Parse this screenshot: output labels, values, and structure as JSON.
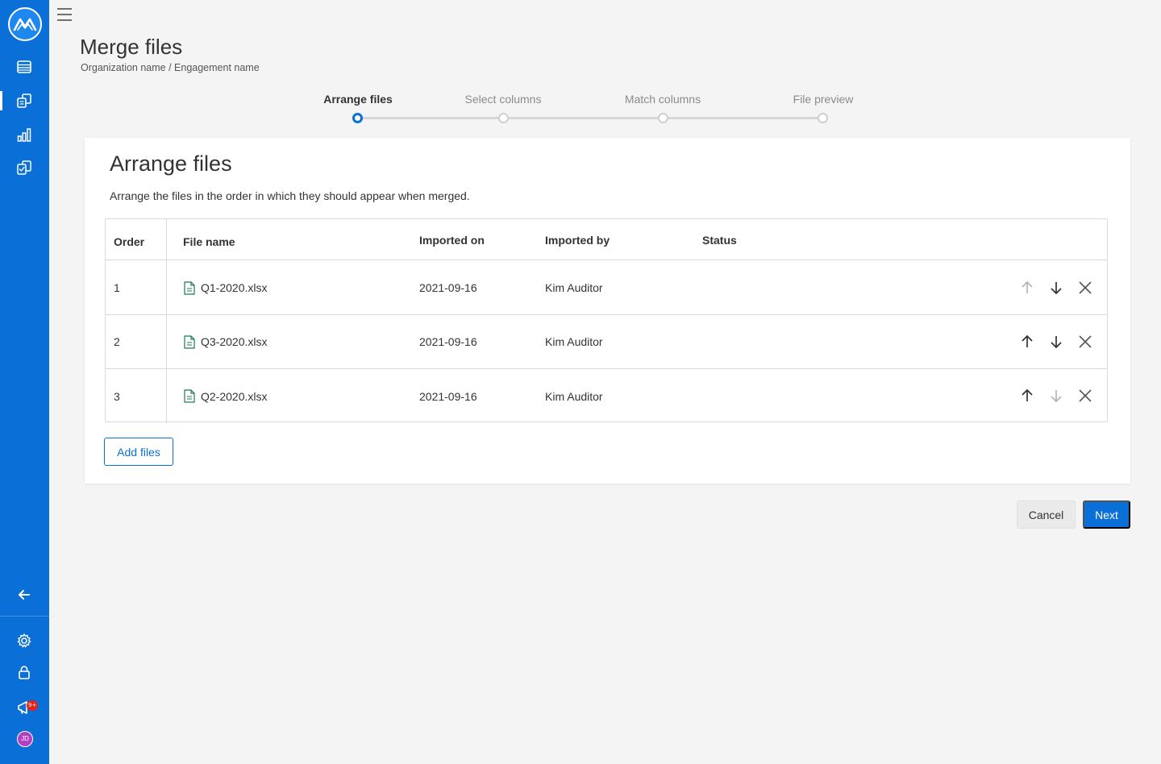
{
  "page": {
    "title": "Merge files",
    "breadcrumb": "Organization name / Engagement name"
  },
  "sidebar": {
    "items": [
      {
        "icon": "logo-icon"
      },
      {
        "icon": "table-icon"
      },
      {
        "icon": "files-icon",
        "active": true
      },
      {
        "icon": "bar-chart-icon"
      },
      {
        "icon": "checklist-icon"
      },
      {
        "icon": "collapse-arrow-icon"
      },
      {
        "icon": "gear-icon"
      },
      {
        "icon": "lock-icon"
      },
      {
        "icon": "megaphone-icon"
      },
      {
        "icon": "avatar"
      }
    ],
    "notification_badge": "9+",
    "avatar_initials": "JD"
  },
  "stepper": {
    "steps": [
      {
        "label": "Arrange files",
        "active": true
      },
      {
        "label": "Select columns",
        "active": false
      },
      {
        "label": "Match columns",
        "active": false
      },
      {
        "label": "File preview",
        "active": false
      }
    ]
  },
  "card": {
    "title": "Arrange files",
    "description": "Arrange the files in the order in which they should appear when merged."
  },
  "table": {
    "headers": {
      "order": "Order",
      "file_name": "File name",
      "imported_on": "Imported on",
      "imported_by": "Imported by",
      "status": "Status"
    },
    "rows": [
      {
        "order": "1",
        "file_name": "Q1-2020.xlsx",
        "imported_on": "2021-09-16",
        "imported_by": "Kim Auditor",
        "status": "",
        "up_enabled": false,
        "down_enabled": true
      },
      {
        "order": "2",
        "file_name": "Q3-2020.xlsx",
        "imported_on": "2021-09-16",
        "imported_by": "Kim Auditor",
        "status": "",
        "up_enabled": true,
        "down_enabled": true
      },
      {
        "order": "3",
        "file_name": "Q2-2020.xlsx",
        "imported_on": "2021-09-16",
        "imported_by": "Kim Auditor",
        "status": "",
        "up_enabled": true,
        "down_enabled": false
      }
    ]
  },
  "buttons": {
    "add_files": "Add files",
    "cancel": "Cancel",
    "next": "Next"
  },
  "colors": {
    "brand": "#0a6fd6",
    "sidebar": "#0a6fd6",
    "background": "#f4f4f4",
    "badge": "#e0241a",
    "avatar": "#b23ec4",
    "icon_enabled": "#333333",
    "icon_disabled": "#b5b5b5"
  }
}
